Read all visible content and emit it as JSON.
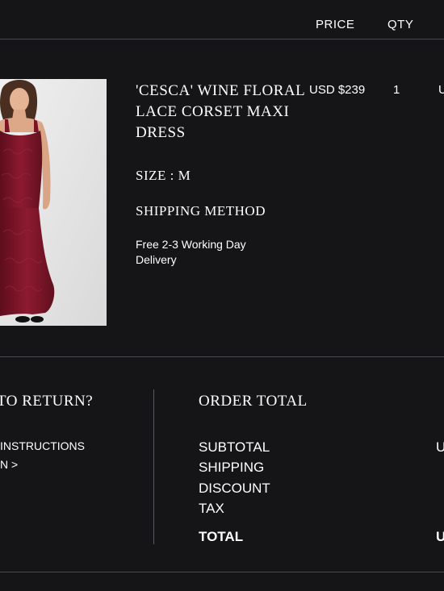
{
  "table_header": {
    "price": "PRICE",
    "qty": "QTY",
    "total_partial": "U"
  },
  "item": {
    "image_alt": "Model wearing wine red lace maxi dress",
    "title": "'CESCA' WINE FLORAL LACE CORSET MAXI DRESS",
    "price": "USD $239",
    "qty": "1",
    "total_partial": "U",
    "size": "SIZE : M",
    "shipping_label": "SHIPPING METHOD",
    "shipping_value": "Free 2-3 Working Day Delivery"
  },
  "returns": {
    "heading_partial": "TO RETURN?",
    "link_line1": "INSTRUCTIONS",
    "link_line2": "N >"
  },
  "order_total": {
    "heading": "ORDER TOTAL",
    "subtotal_label": "SUBTOTAL",
    "subtotal_value_partial": "U",
    "shipping_label": "SHIPPING",
    "discount_label": "DISCOUNT",
    "tax_label": "TAX",
    "total_label": "TOTAL",
    "total_value_partial": "U"
  },
  "colors": {
    "background": "#151517",
    "text": "#ffffff",
    "divider": "#4a4a4e",
    "dress": "#7c1426"
  }
}
